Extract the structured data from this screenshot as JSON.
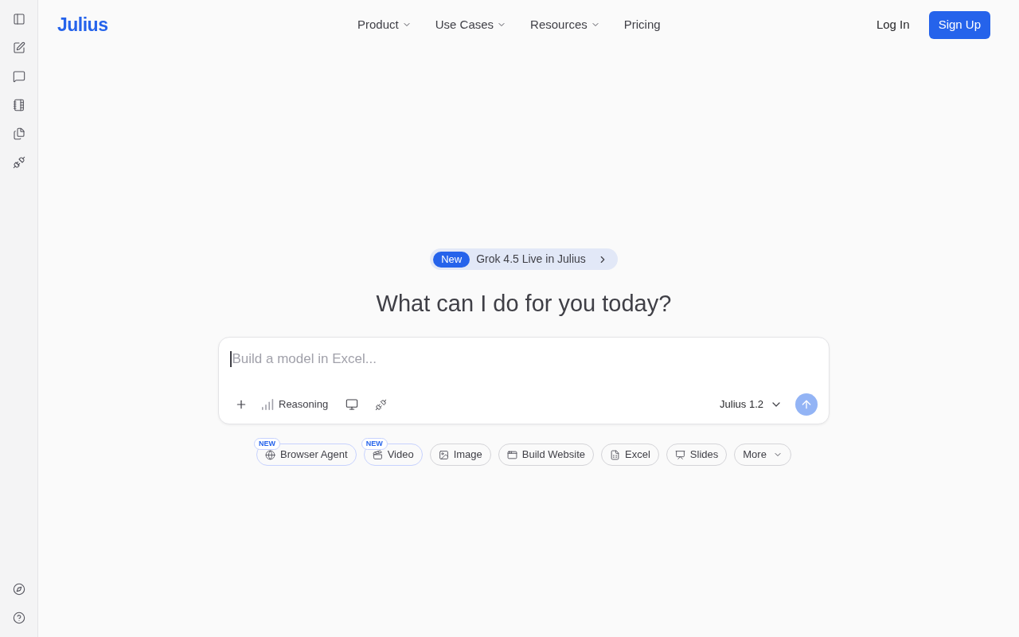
{
  "logo": "Julius",
  "nav": [
    {
      "label": "Product",
      "has_menu": true
    },
    {
      "label": "Use Cases",
      "has_menu": true
    },
    {
      "label": "Resources",
      "has_menu": true
    },
    {
      "label": "Pricing",
      "has_menu": false
    }
  ],
  "auth": {
    "login": "Log In",
    "signup": "Sign Up"
  },
  "announcement": {
    "badge": "New",
    "text": "Grok 4.5 Live in Julius"
  },
  "heading": "What can I do for you today?",
  "composer": {
    "placeholder": "Build a model in Excel...",
    "focused": true,
    "reasoning_label": "Reasoning",
    "model": "Julius 1.2",
    "send_disabled": true
  },
  "chips": [
    {
      "kind": "globe",
      "label": "Browser Agent",
      "badge": "NEW"
    },
    {
      "kind": "video",
      "label": "Video",
      "badge": "NEW"
    },
    {
      "kind": "image",
      "label": "Image"
    },
    {
      "kind": "website",
      "label": "Build Website"
    },
    {
      "kind": "sheet",
      "label": "Excel"
    },
    {
      "kind": "slides",
      "label": "Slides"
    },
    {
      "kind": "more",
      "label": "More"
    }
  ]
}
